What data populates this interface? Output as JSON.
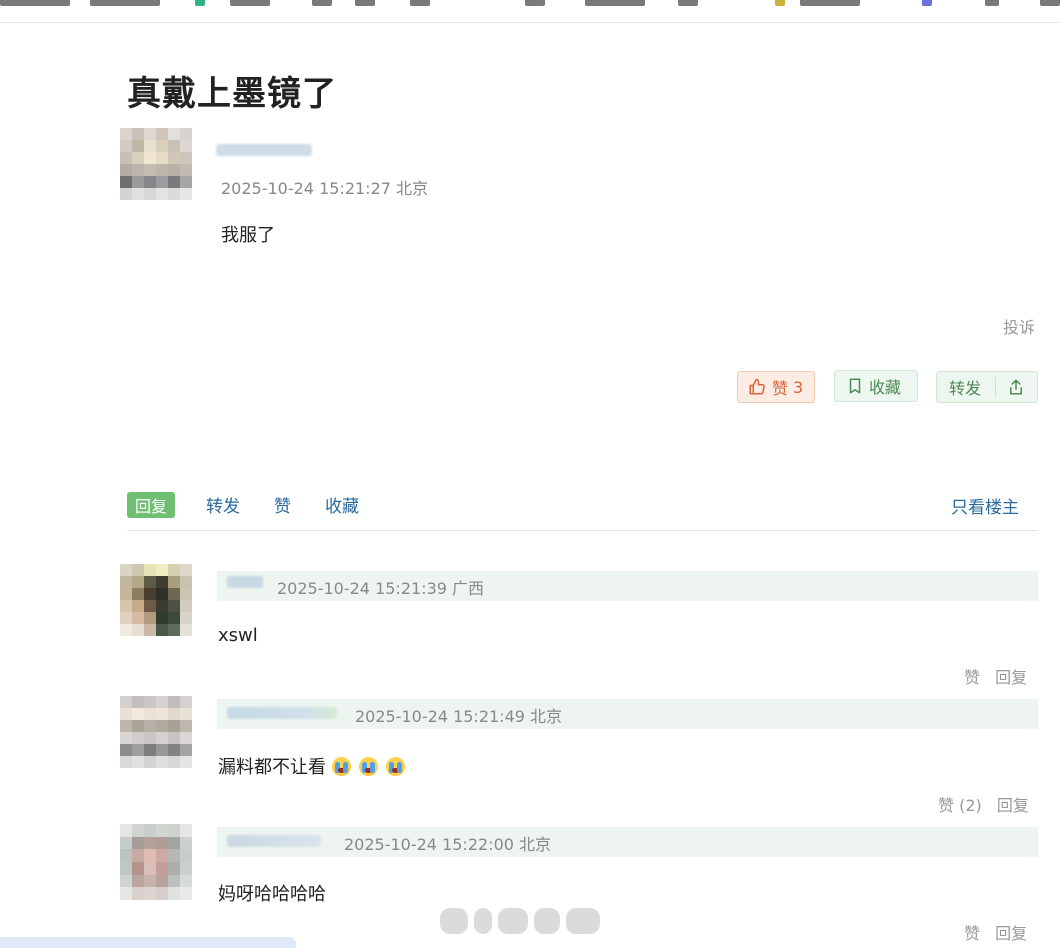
{
  "post": {
    "title": "真戴上墨镜了",
    "time": "2025-10-24 15:21:27",
    "location": "北京",
    "content": "我服了",
    "report": "投诉",
    "like_label": "赞",
    "like_count": "3",
    "fav_label": "收藏",
    "share_label": "转发"
  },
  "tabs": {
    "items": [
      "回复",
      "转发",
      "赞",
      "收藏"
    ],
    "only_op": "只看楼主"
  },
  "replies": [
    {
      "time": "2025-10-24 15:21:39",
      "location": "广西",
      "content": "xswl",
      "like": "赞",
      "reply": "回复"
    },
    {
      "time": "2025-10-24 15:21:49",
      "location": "北京",
      "content": "漏料都不让看",
      "emoji_count": 3,
      "like": "赞 (2)",
      "reply": "回复"
    },
    {
      "time": "2025-10-24 15:22:00",
      "location": "北京",
      "content": "妈呀哈哈哈哈",
      "like": "赞",
      "reply": "回复"
    }
  ],
  "colors": {
    "like_accent": "#d9643a",
    "green_accent": "#4d8a57",
    "active_tab": "#6fbf73",
    "link": "#2a6a9e"
  },
  "icons": [
    "thumb-up-icon",
    "bookmark-icon",
    "share-icon",
    "crying-emoji-icon"
  ]
}
